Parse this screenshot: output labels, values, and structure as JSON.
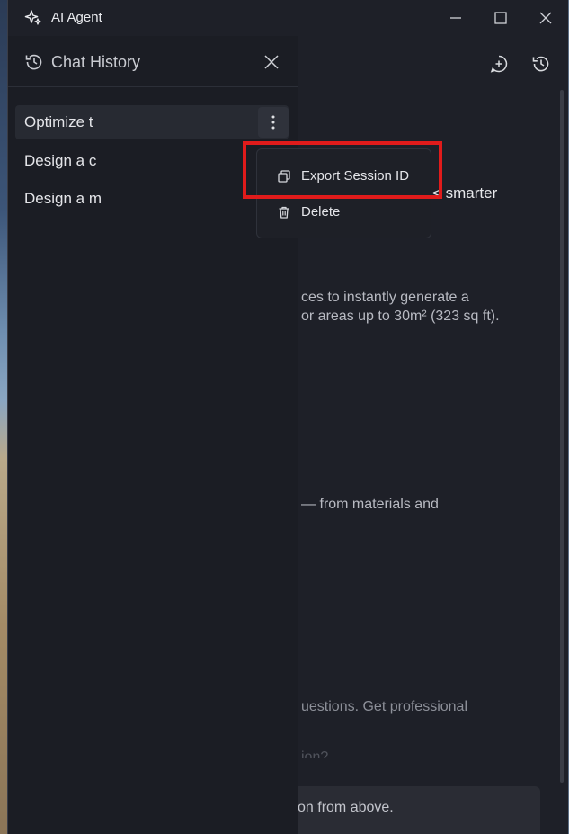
{
  "window": {
    "title": "AI Agent"
  },
  "sidebar": {
    "title": "Chat History",
    "items": [
      {
        "label": "Optimize t"
      },
      {
        "label": "Design a c"
      },
      {
        "label": "Design a m"
      }
    ]
  },
  "menu": {
    "items": [
      {
        "label": "Export Session ID",
        "icon": "copy-icon"
      },
      {
        "label": "Delete",
        "icon": "trash-icon"
      }
    ]
  },
  "main": {
    "line1": "< smarter",
    "line2": "ces to instantly generate a",
    "line3": "or areas up to 30m² (323 sq ft).",
    "line4": "— from materials and",
    "line5": "uestions. Get professional",
    "line6": "ion?",
    "input_text": "on from above."
  },
  "colors": {
    "highlight": "#e01b1b",
    "background": "#1e2028"
  }
}
